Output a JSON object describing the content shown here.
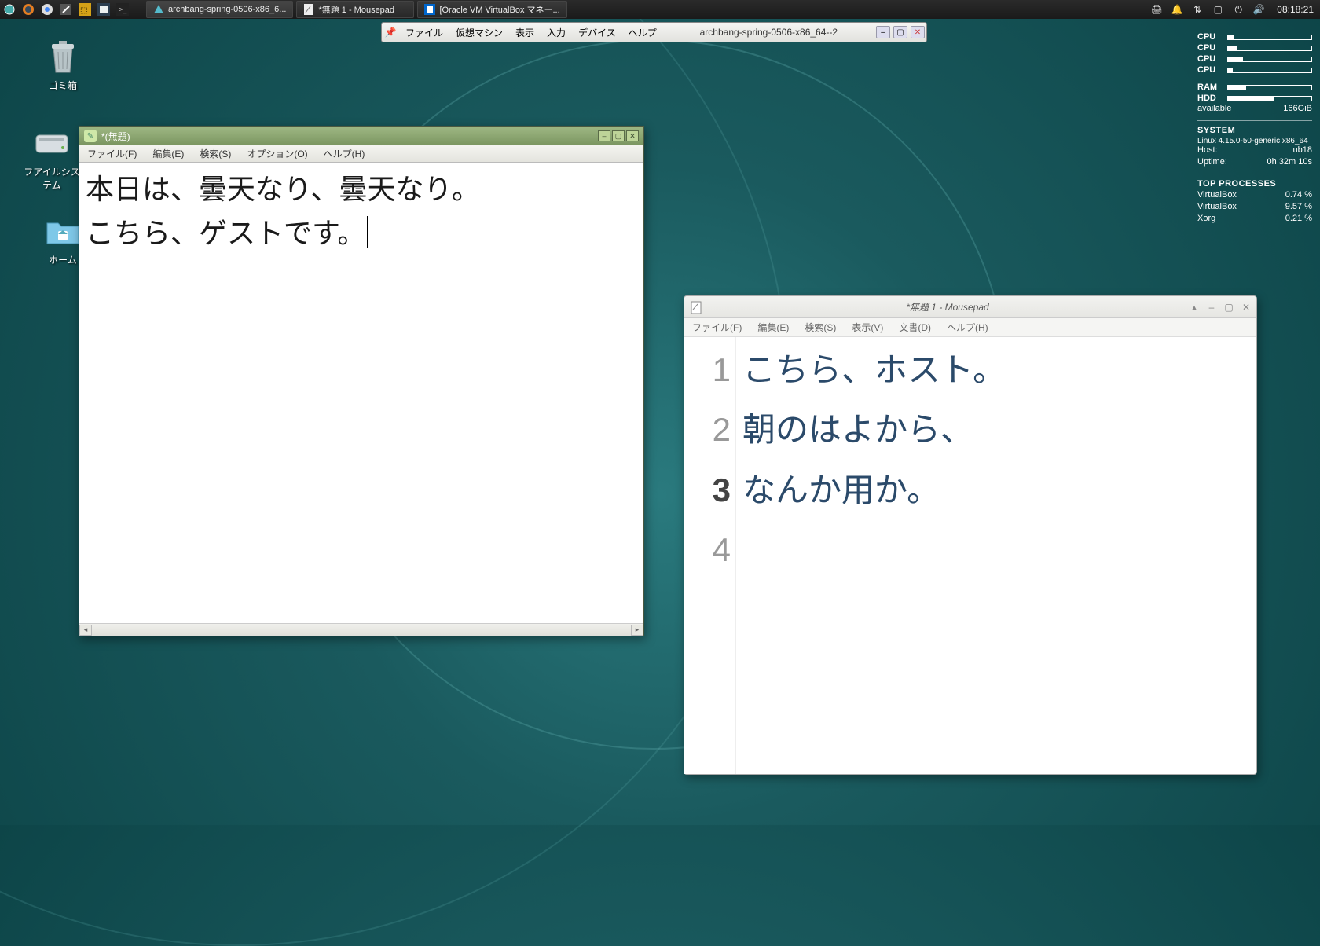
{
  "panel": {
    "tasks": [
      {
        "icon": "▲",
        "label": "archbang-spring-0506-x86_6...",
        "active": true
      },
      {
        "icon": "✎",
        "label": "*無題 1 - Mousepad"
      },
      {
        "icon": "◧",
        "label": "[Oracle VM VirtualBox マネー..."
      }
    ],
    "clock": "08:18:21"
  },
  "desktop": {
    "trash": "ゴミ箱",
    "filesystem": "フアイルシステム",
    "home": "ホーム"
  },
  "vbox_bar": {
    "menus": [
      "ファイル",
      "仮想マシン",
      "表示",
      "入力",
      "デバイス",
      "ヘルプ"
    ],
    "title": "archbang-spring-0506-x86_64--2"
  },
  "leafpad": {
    "title": "*(無題)",
    "menus": [
      "ファイル(F)",
      "編集(E)",
      "検索(S)",
      "オプション(O)",
      "ヘルプ(H)"
    ],
    "line1": "本日は、曇天なり、曇天なり。",
    "line2": "こちら、ゲストです。"
  },
  "mousepad": {
    "title": "*無題 1 - Mousepad",
    "menus": [
      "ファイル(F)",
      "編集(E)",
      "検索(S)",
      "表示(V)",
      "文書(D)",
      "ヘルプ(H)"
    ],
    "lines": [
      "こちら、ホスト。",
      "朝のはよから、",
      "なんか用か。",
      ""
    ],
    "current_line": 3
  },
  "conky": {
    "cpus": [
      {
        "label": "CPU",
        "pct": 8
      },
      {
        "label": "CPU",
        "pct": 10
      },
      {
        "label": "CPU",
        "pct": 18
      },
      {
        "label": "CPU",
        "pct": 6
      }
    ],
    "ram": {
      "label": "RAM",
      "pct": 22
    },
    "hdd": {
      "label": "HDD",
      "pct": 55
    },
    "available": {
      "label": "available",
      "value": "166GiB"
    },
    "system_hdr": "SYSTEM",
    "kernel": "Linux 4.15.0-50-generic x86_64",
    "host": {
      "label": "Host:",
      "value": "ub18"
    },
    "uptime": {
      "label": "Uptime:",
      "value": "0h 32m 10s"
    },
    "top_hdr": "TOP PROCESSES",
    "procs": [
      {
        "name": "VirtualBox",
        "pct": "0.74 %"
      },
      {
        "name": "VirtualBox",
        "pct": "9.57 %"
      },
      {
        "name": "Xorg",
        "pct": "0.21 %"
      }
    ]
  }
}
